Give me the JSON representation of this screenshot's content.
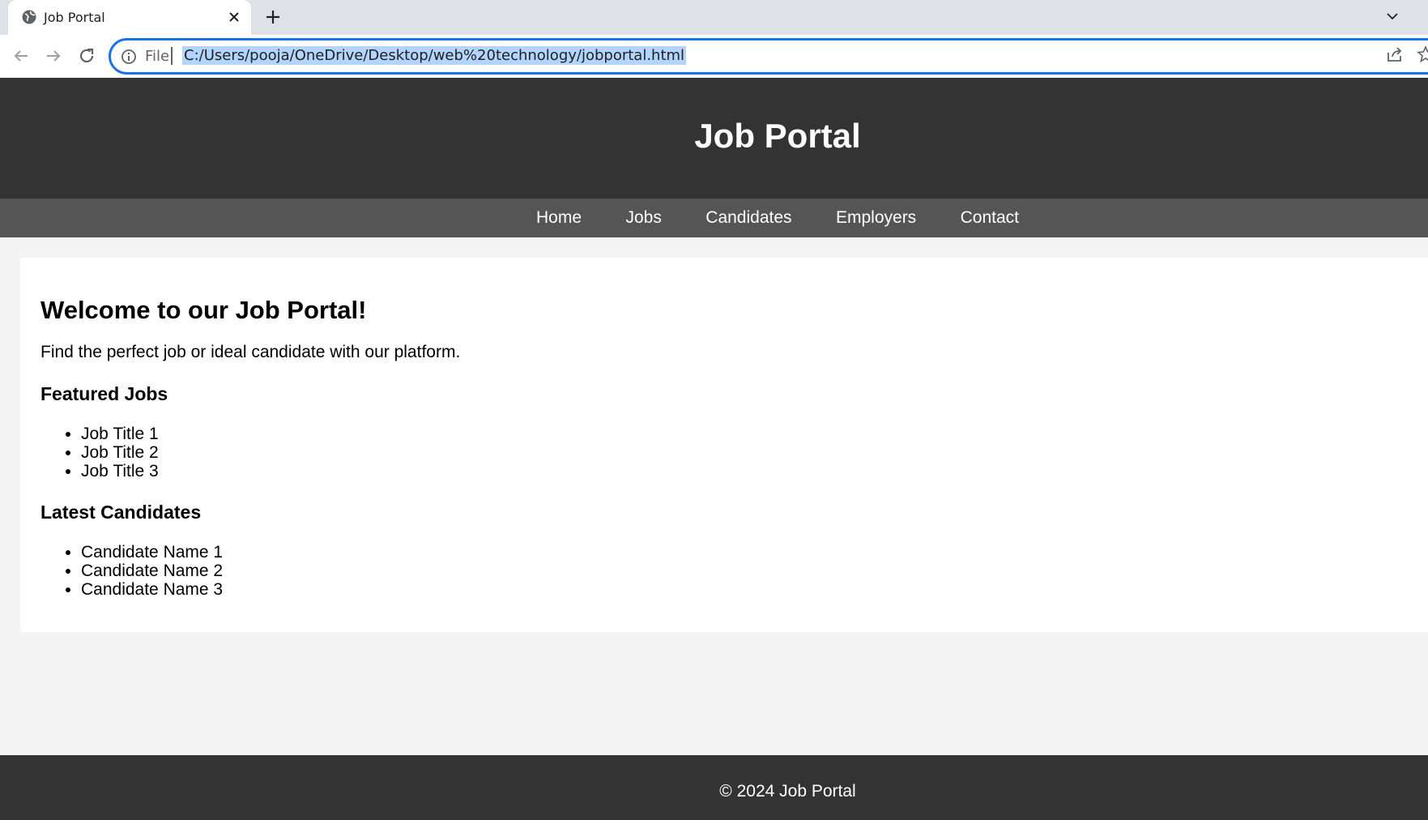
{
  "browser": {
    "tab_title": "Job Portal",
    "file_label": "File",
    "url": "C:/Users/pooja/OneDrive/Desktop/web%20technology/jobportal.html"
  },
  "header": {
    "title": "Job Portal"
  },
  "nav": {
    "items": [
      "Home",
      "Jobs",
      "Candidates",
      "Employers",
      "Contact"
    ]
  },
  "main": {
    "welcome_heading": "Welcome to our Job Portal!",
    "intro": "Find the perfect job or ideal candidate with our platform.",
    "featured_heading": "Featured Jobs",
    "featured_jobs": [
      "Job Title 1",
      "Job Title 2",
      "Job Title 3"
    ],
    "candidates_heading": "Latest Candidates",
    "candidates": [
      "Candidate Name 1",
      "Candidate Name 2",
      "Candidate Name 3"
    ]
  },
  "footer": {
    "text": "© 2024 Job Portal"
  },
  "colors": {
    "header_bg": "#333333",
    "nav_bg": "#555555",
    "page_bg": "#f4f4f4",
    "accent": "#1a73e8"
  }
}
